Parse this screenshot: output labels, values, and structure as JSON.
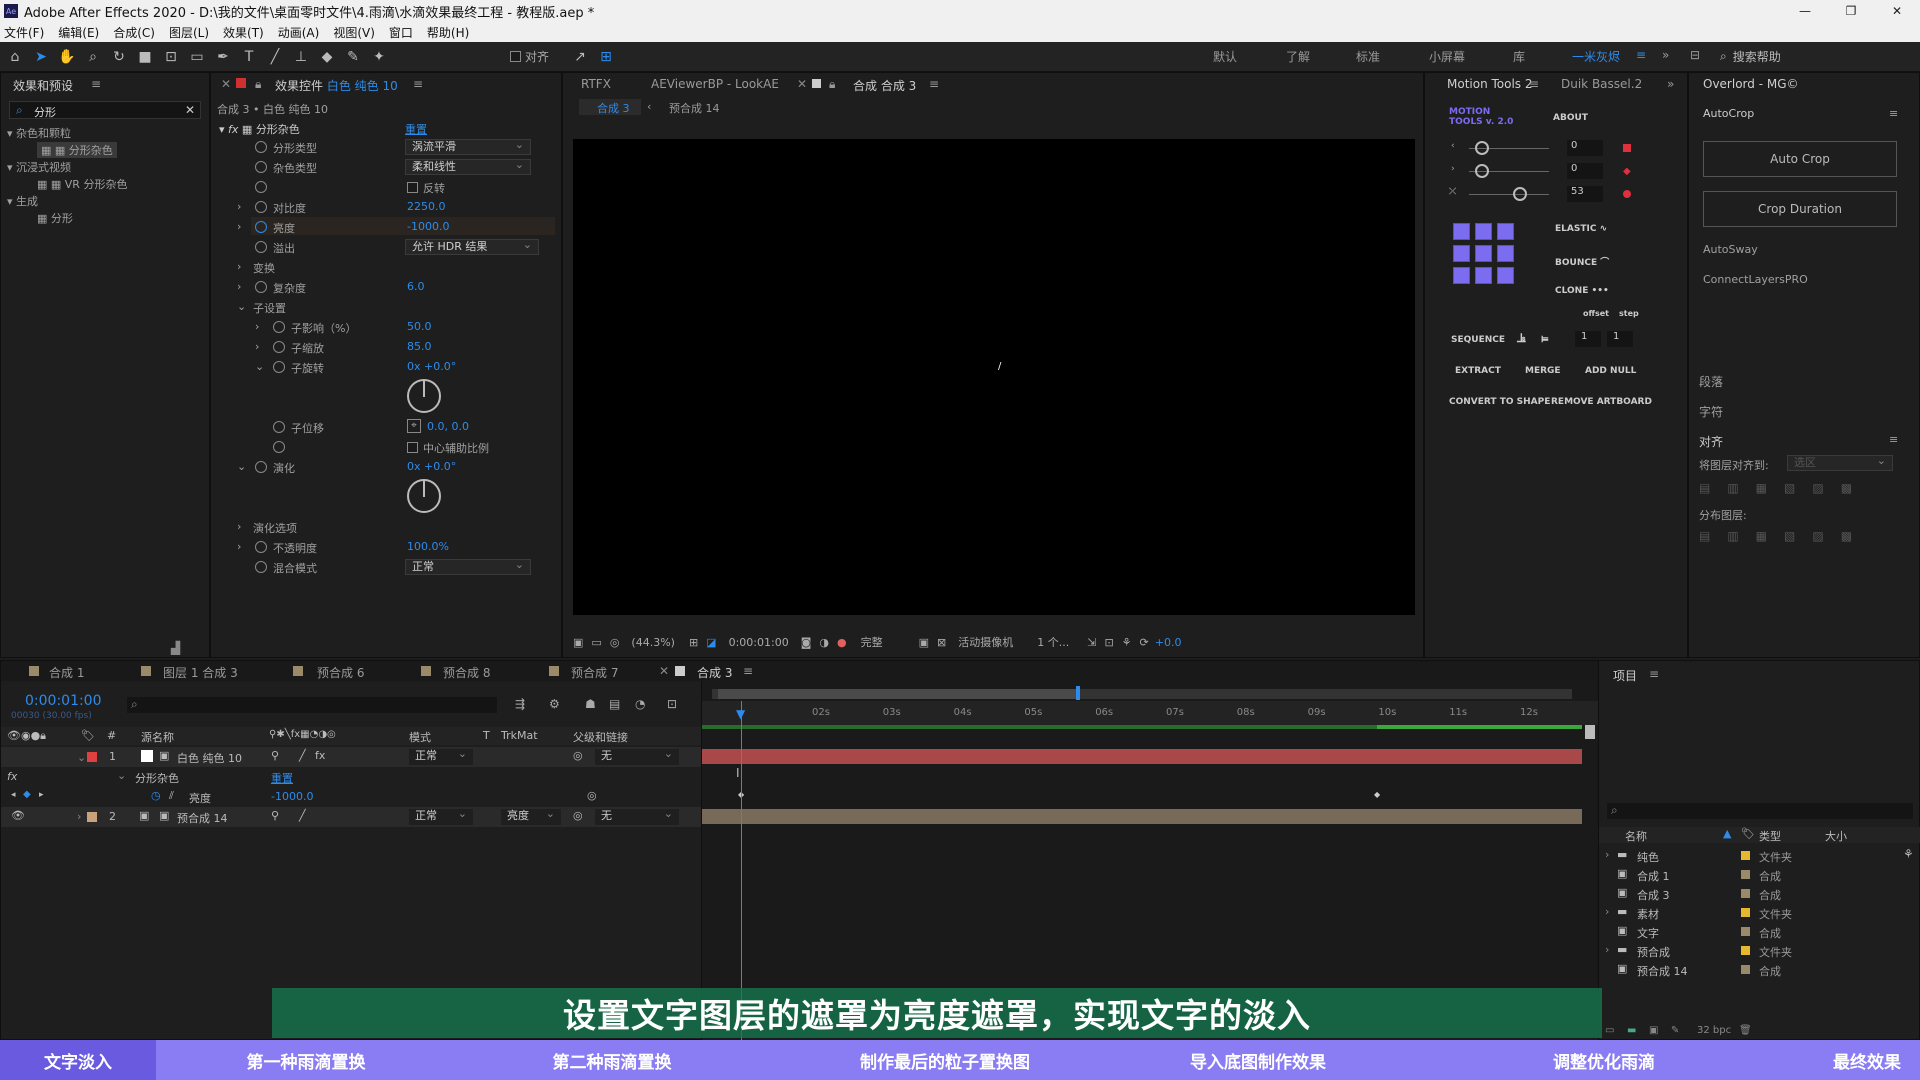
{
  "window": {
    "title": "Adobe After Effects 2020 - D:\\我的文件\\桌面零时文件\\4.雨滴\\水滴效果最终工程 - 教程版.aep *",
    "app_icon": "Ae",
    "controls": [
      "—",
      "❐",
      "✕"
    ]
  },
  "menu": [
    "文件(F)",
    "编辑(E)",
    "合成(C)",
    "图层(L)",
    "效果(T)",
    "动画(A)",
    "视图(V)",
    "窗口",
    "帮助(H)"
  ],
  "toolbar": {
    "align_label": "对齐",
    "workspaces": [
      "默认",
      "了解",
      "标准",
      "小屏幕",
      "库",
      "一米灰烬"
    ],
    "active_workspace": "一米灰烬",
    "search_help": "搜索帮助"
  },
  "effects_panel": {
    "title": "效果和预设",
    "search_value": "分形",
    "tree": [
      {
        "label": "杂色和颗粒",
        "level": 0
      },
      {
        "label": "分形杂色",
        "level": 1,
        "selected": true
      },
      {
        "label": "沉浸式视频",
        "level": 0
      },
      {
        "label": "VR 分形杂色",
        "level": 1
      },
      {
        "label": "生成",
        "level": 0
      },
      {
        "label": "分形",
        "level": 1
      }
    ]
  },
  "effect_controls": {
    "tab_prefix": "效果控件",
    "tab_layer": "白色 纯色 10",
    "breadcrumb": "合成 3 • 白色 纯色 10",
    "effect_name": "分形杂色",
    "reset": "重置",
    "props": {
      "fractal_type_label": "分形类型",
      "fractal_type_value": "涡流平滑",
      "noise_type_label": "杂色类型",
      "noise_type_value": "柔和线性",
      "invert_label": "反转",
      "contrast_label": "对比度",
      "contrast_value": "2250.0",
      "brightness_label": "亮度",
      "brightness_value": "-1000.0",
      "overflow_label": "溢出",
      "overflow_value": "允许 HDR 结果",
      "transform_label": "变换",
      "complexity_label": "复杂度",
      "complexity_value": "6.0",
      "sub_settings_label": "子设置",
      "sub_influence_label": "子影响（%）",
      "sub_influence_value": "50.0",
      "sub_scale_label": "子缩放",
      "sub_scale_value": "85.0",
      "sub_rotation_label": "子旋转",
      "sub_rotation_value": "0x +0.0°",
      "sub_offset_label": "子位移",
      "sub_offset_value": "0.0, 0.0",
      "center_label": "中心辅助比例",
      "evolution_label": "演化",
      "evolution_value": "0x +0.0°",
      "evolution_options_label": "演化选项",
      "opacity_label": "不透明度",
      "opacity_value": "100.0%",
      "blend_label": "混合模式",
      "blend_value": "正常"
    }
  },
  "viewer": {
    "tabs": [
      "RTFX",
      "AEViewerBP - LookAE",
      "合成 合成 3"
    ],
    "active_tab": "合成 合成 3",
    "sub_tabs": [
      "合成 3",
      "预合成 14"
    ],
    "zoom": "(44.3%)",
    "timecode": "0:00:01:00",
    "quality": "完整",
    "camera": "活动摄像机",
    "views": "1 个...",
    "exposure": "+0.0"
  },
  "motion_tools": {
    "tab": "Motion Tools 2",
    "tab2": "Duik Bassel.2",
    "logo_line1": "MOTION",
    "logo_line2": "TOOLS v. 2.0",
    "about": "ABOUT",
    "slider_values": [
      "0",
      "0",
      "53"
    ],
    "elastic": "ELASTIC",
    "bounce": "BOUNCE",
    "clone": "CLONE",
    "offset": "offset",
    "step": "step",
    "sequence": "SEQUENCE",
    "seq_values": [
      "1",
      "1"
    ],
    "extract": "EXTRACT",
    "merge": "MERGE",
    "add_null": "ADD NULL",
    "convert": "CONVERT TO SHAPE",
    "remove_artboard": "REMOVE ARTBOARD"
  },
  "right_panel": {
    "tab": "Overlord - MG©",
    "autocrop": "AutoCrop",
    "auto_crop_btn": "Auto Crop",
    "crop_duration_btn": "Crop Duration",
    "autosway": "AutoSway",
    "connect": "ConnectLayersPRO",
    "paragraph": "段落",
    "character": "字符",
    "align": "对齐",
    "align_to": "将图层对齐到:",
    "align_to_value": "选区",
    "distribute": "分布图层:"
  },
  "timeline": {
    "tabs": [
      "合成 1",
      "图层 1 合成 3",
      "预合成 6",
      "预合成 8",
      "预合成 7",
      "合成 3"
    ],
    "active_tab": "合成 3",
    "timecode": "0:00:01:00",
    "frame_info": "00030 (30.00 fps)",
    "col_source": "源名称",
    "col_mode": "模式",
    "col_t": "T",
    "col_trkmat": "TrkMat",
    "col_parent": "父级和链接",
    "ruler": [
      "02s",
      "03s",
      "04s",
      "05s",
      "06s",
      "07s",
      "08s",
      "09s",
      "10s",
      "11s",
      "12s"
    ],
    "layers": [
      {
        "num": "1",
        "name": "白色 纯色 10",
        "mode": "正常",
        "parent": "无",
        "label_color": "#e04040"
      },
      {
        "num": "2",
        "name": "预合成 14",
        "mode": "正常",
        "trkmat": "亮度",
        "parent": "无",
        "label_color": "#c8a27a"
      }
    ],
    "fx_effect": "分形杂色",
    "fx_reset": "重置",
    "fx_prop": "亮度",
    "fx_value": "-1000.0"
  },
  "project": {
    "title": "项目",
    "col_name": "名称",
    "col_type": "类型",
    "col_size": "大小",
    "items": [
      {
        "name": "纯色",
        "type": "文件夹",
        "folder": true
      },
      {
        "name": "合成 1",
        "type": "合成",
        "folder": false
      },
      {
        "name": "合成 3",
        "type": "合成",
        "folder": false
      },
      {
        "name": "素材",
        "type": "文件夹",
        "folder": true
      },
      {
        "name": "文字",
        "type": "合成",
        "folder": false
      },
      {
        "name": "预合成",
        "type": "文件夹",
        "folder": true
      },
      {
        "name": "预合成 14",
        "type": "合成",
        "folder": false
      }
    ],
    "bpc": "32 bpc"
  },
  "subtitle": "设置文字图层的遮罩为亮度遮罩，实现文字的淡入",
  "chapters": [
    {
      "label": "文字淡入",
      "active": true
    },
    {
      "label": "第一种雨滴置换",
      "active": false
    },
    {
      "label": "第二种雨滴置换",
      "active": false
    },
    {
      "label": "制作最后的粒子置换图",
      "active": false
    },
    {
      "label": "导入底图制作效果",
      "active": false
    },
    {
      "label": "调整优化雨滴",
      "active": false
    },
    {
      "label": "最终效果",
      "active": false
    }
  ]
}
